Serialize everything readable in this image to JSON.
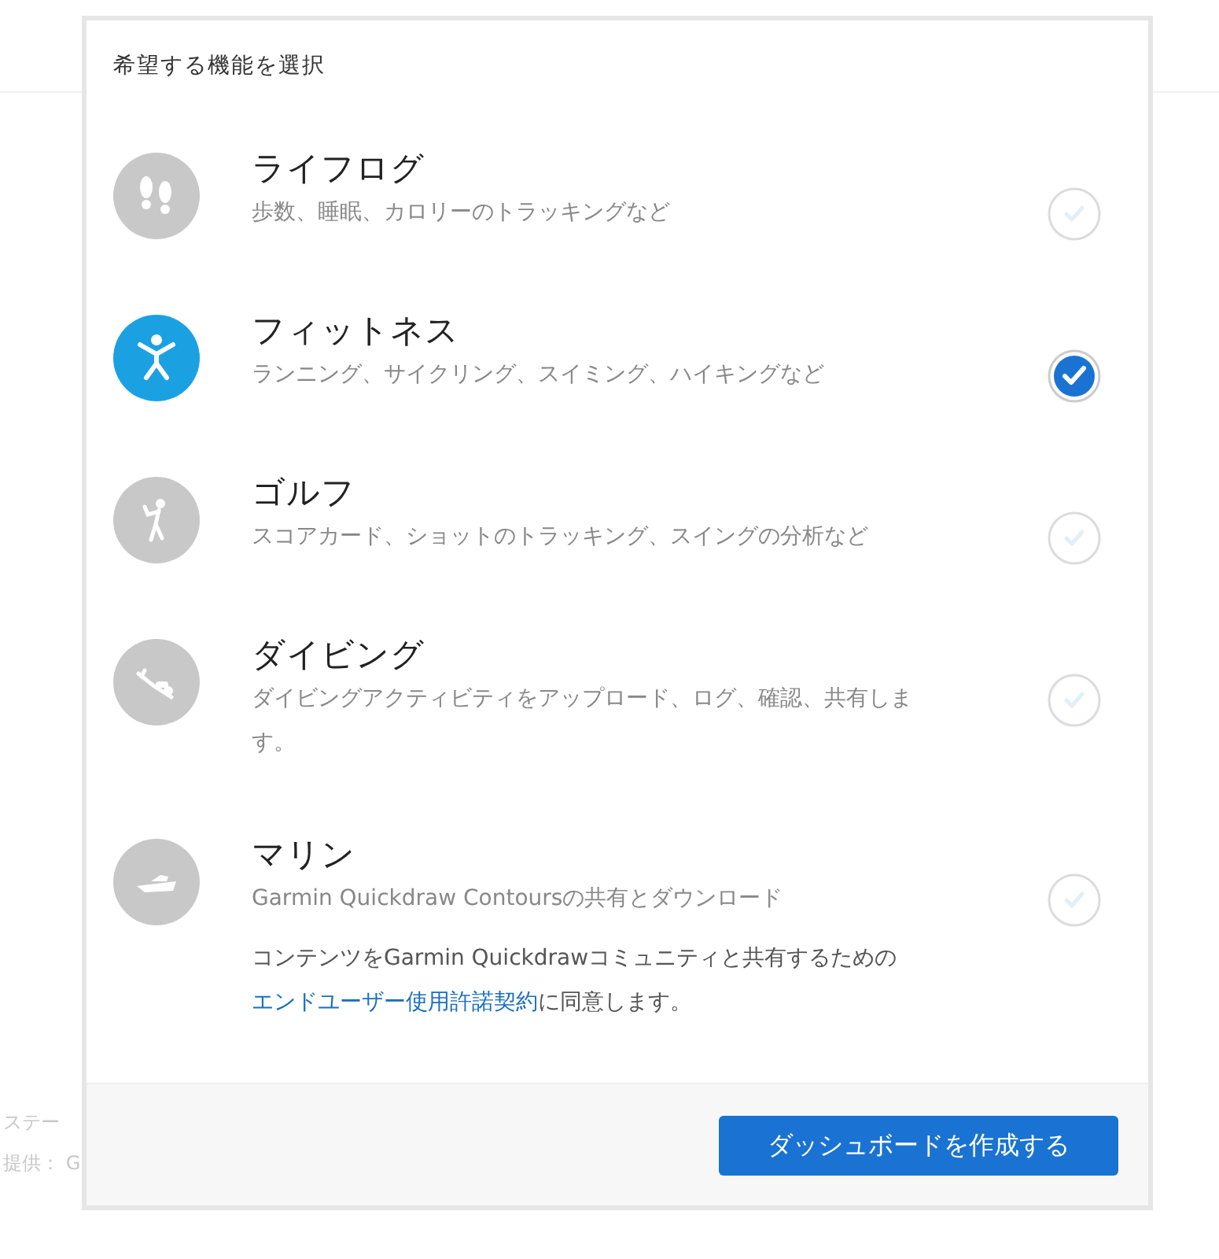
{
  "background_texts": [
    "ステー",
    "提供： G"
  ],
  "dialog": {
    "title": "希望する機能を選択",
    "features": [
      {
        "kind": "footprints",
        "title": "ライフログ",
        "description": "歩数、睡眠、カロリーのトラッキングなど",
        "selected": false
      },
      {
        "kind": "fitness",
        "title": "フィットネス",
        "description": "ランニング、サイクリング、スイミング、ハイキングなど",
        "selected": true
      },
      {
        "kind": "golf",
        "title": "ゴルフ",
        "description": "スコアカード、ショットのトラッキング、スイングの分析など",
        "selected": false
      },
      {
        "kind": "diving",
        "title": "ダイビング",
        "description": "ダイビングアクティビティをアップロード、ログ、確認、共有します。",
        "selected": false
      },
      {
        "kind": "boat",
        "title": "マリン",
        "description": "Garmin Quickdraw Contoursの共有とダウンロード",
        "selected": false,
        "agreement": {
          "before": "コンテンツをGarmin Quickdrawコミュニティと共有するための",
          "link": "エンドユーザー使用許諾契約",
          "after": "に同意します。"
        }
      }
    ],
    "button": "ダッシュボードを作成する"
  }
}
